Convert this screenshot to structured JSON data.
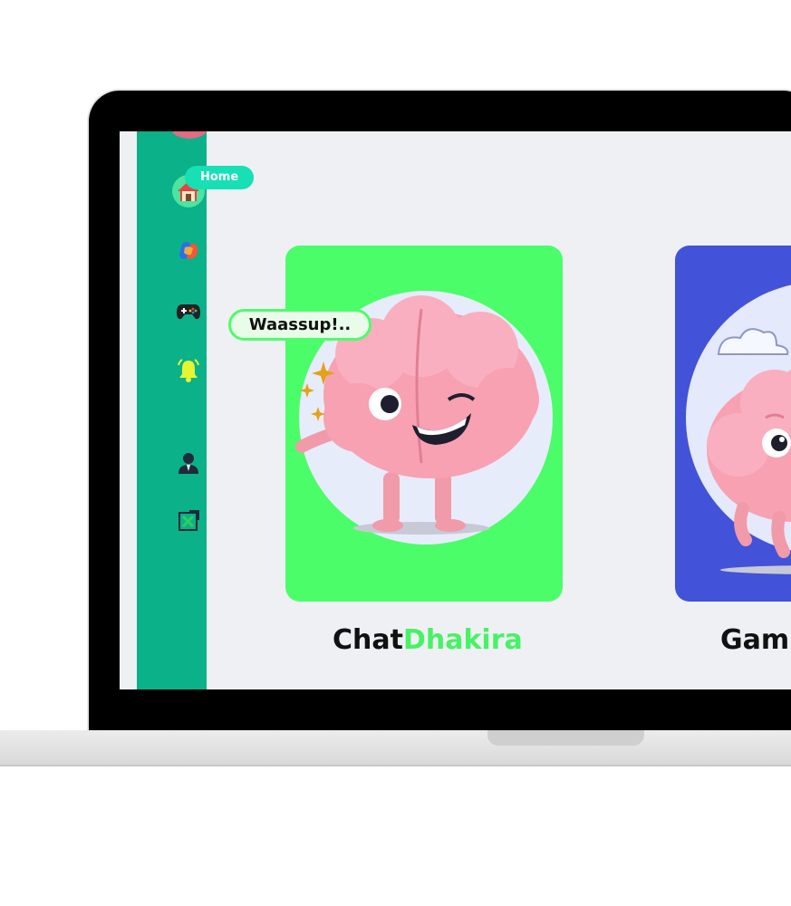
{
  "sidebar": {
    "items": [
      {
        "name": "home",
        "icon": "house-icon"
      },
      {
        "name": "copilot",
        "icon": "copilot-icon"
      },
      {
        "name": "games",
        "icon": "gamepad-icon"
      },
      {
        "name": "notifications",
        "icon": "bell-icon"
      },
      {
        "name": "profile",
        "icon": "user-icon"
      },
      {
        "name": "logout",
        "icon": "check-box-icon"
      }
    ],
    "active_label": "Home"
  },
  "cards": [
    {
      "speech": "Waassup!..",
      "title_part1": "Chat",
      "title_part2": "Dhakira",
      "bg": "#4cfd6a"
    },
    {
      "title_part1": "Gam",
      "bg": "#4252d9"
    }
  ],
  "colors": {
    "sidebar": "#0bb189",
    "accent": "#47f265",
    "pill": "#16e0b4"
  }
}
